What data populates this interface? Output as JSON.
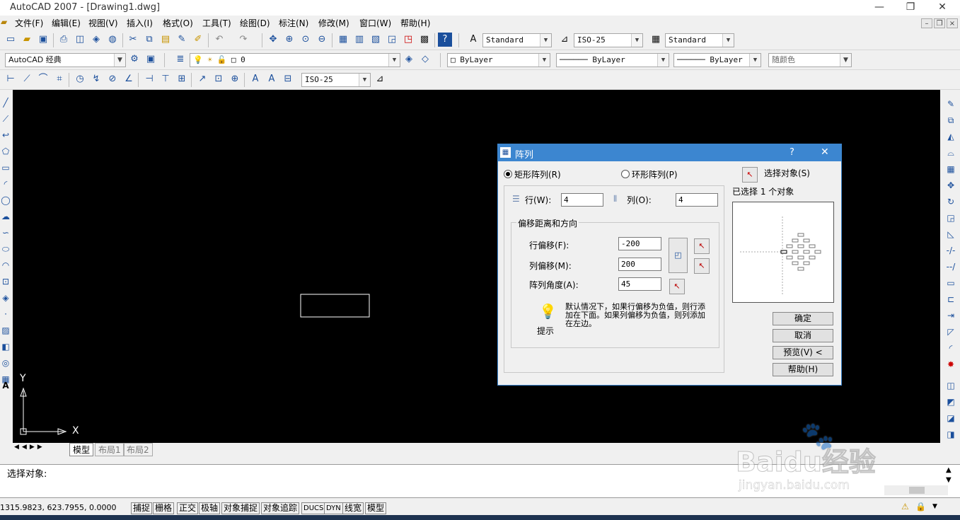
{
  "window": {
    "title": "AutoCAD 2007 - [Drawing1.dwg]",
    "minimize": "—",
    "restore": "❐",
    "close": "✕"
  },
  "menu": [
    "文件(F)",
    "编辑(E)",
    "视图(V)",
    "插入(I)",
    "格式(O)",
    "工具(T)",
    "绘图(D)",
    "标注(N)",
    "修改(M)",
    "窗口(W)",
    "帮助(H)"
  ],
  "toolbar": {
    "text_style": "Standard",
    "dim_style": "ISO-25",
    "table_style": "Standard",
    "workspace": "AutoCAD 经典",
    "layer": "0",
    "color": "ByLayer",
    "linetype": "ByLayer",
    "lineweight": "ByLayer",
    "plot_style": "随颜色",
    "dim_style2": "ISO-25"
  },
  "canvas": {
    "ucs_y": "Y",
    "ucs_x": "X"
  },
  "tabs": [
    "模型",
    "布局1",
    "布局2"
  ],
  "command": {
    "prompt": "选择对象:"
  },
  "status": {
    "coords": "1315.9823, 623.7955, 0.0000",
    "toggles": [
      "捕捉",
      "栅格",
      "正交",
      "极轴",
      "对象捕捉",
      "对象追踪",
      "DUCS",
      "DYN",
      "线宽",
      "模型"
    ]
  },
  "dialog": {
    "title": "阵列",
    "help": "?",
    "close": "✕",
    "rect_label": "矩形阵列(R)",
    "polar_label": "环形阵列(P)",
    "rows_label": "行(W):",
    "rows_value": "4",
    "cols_label": "列(O):",
    "cols_value": "4",
    "offset_group": "偏移距离和方向",
    "row_offset_label": "行偏移(F):",
    "row_offset_value": "-200",
    "col_offset_label": "列偏移(M):",
    "col_offset_value": "200",
    "angle_label": "阵列角度(A):",
    "angle_value": "45",
    "tip_label": "提示",
    "tip_text": "默认情况下，如果行偏移为负值，则行添加在下面。如果列偏移为负值，则列添加在左边。",
    "select_label": "选择对象(S)",
    "selected_text": "已选择 1 个对象",
    "ok": "确定",
    "cancel": "取消",
    "preview": "预览(V) <",
    "help_btn": "帮助(H)"
  },
  "watermark": {
    "text": "Baidu经验",
    "url": "jingyan.baidu.com"
  },
  "colors": {
    "dialog_title": "#3c86d0",
    "canvas": "#000000",
    "annotation_line": "#e0282e"
  }
}
